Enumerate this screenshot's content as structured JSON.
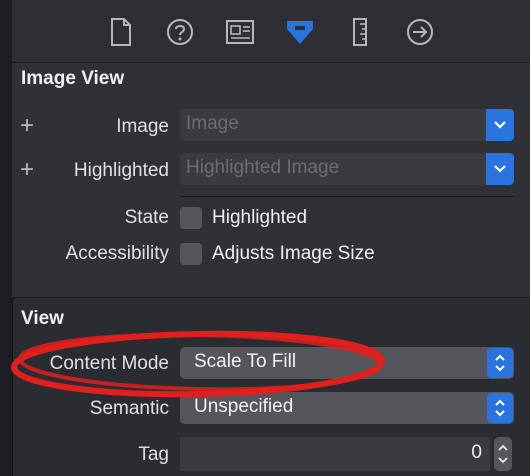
{
  "toolbar": {
    "tabs": [
      {
        "icon": "file-icon"
      },
      {
        "icon": "help-icon"
      },
      {
        "icon": "identity-icon"
      },
      {
        "icon": "attributes-icon",
        "active": true
      },
      {
        "icon": "size-ruler-icon"
      },
      {
        "icon": "connections-arrow-icon"
      }
    ],
    "active_color": "#2a74e0"
  },
  "image_view": {
    "title": "Image View",
    "image": {
      "label": "Image",
      "placeholder": "Image"
    },
    "highlighted": {
      "label": "Highlighted",
      "placeholder": "Highlighted Image"
    },
    "state": {
      "label": "State",
      "checkbox_label": "Highlighted",
      "checked": false
    },
    "accessibility": {
      "label": "Accessibility",
      "checkbox_label": "Adjusts Image Size",
      "checked": false
    }
  },
  "view": {
    "title": "View",
    "content_mode": {
      "label": "Content Mode",
      "value": "Scale To Fill"
    },
    "semantic": {
      "label": "Semantic",
      "value": "Unspecified"
    },
    "tag": {
      "label": "Tag",
      "value": "0"
    }
  },
  "annotation_color": "#e0201c"
}
